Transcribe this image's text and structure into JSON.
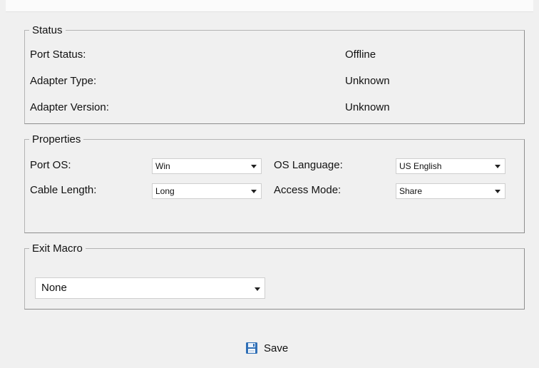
{
  "status": {
    "legend": "Status",
    "rows": [
      {
        "label": "Port Status:",
        "value": "Offline"
      },
      {
        "label": "Adapter Type:",
        "value": "Unknown"
      },
      {
        "label": "Adapter Version:",
        "value": "Unknown"
      }
    ]
  },
  "properties": {
    "legend": "Properties",
    "port_os": {
      "label": "Port OS:",
      "value": "Win"
    },
    "cable_length": {
      "label": "Cable Length:",
      "value": "Long"
    },
    "os_language": {
      "label": "OS Language:",
      "value": "US English"
    },
    "access_mode": {
      "label": "Access Mode:",
      "value": "Share"
    }
  },
  "exit_macro": {
    "legend": "Exit Macro",
    "value": "None"
  },
  "footer": {
    "save_label": "Save",
    "save_icon": "floppy-disk-icon",
    "accent": "#2f6fb6"
  }
}
